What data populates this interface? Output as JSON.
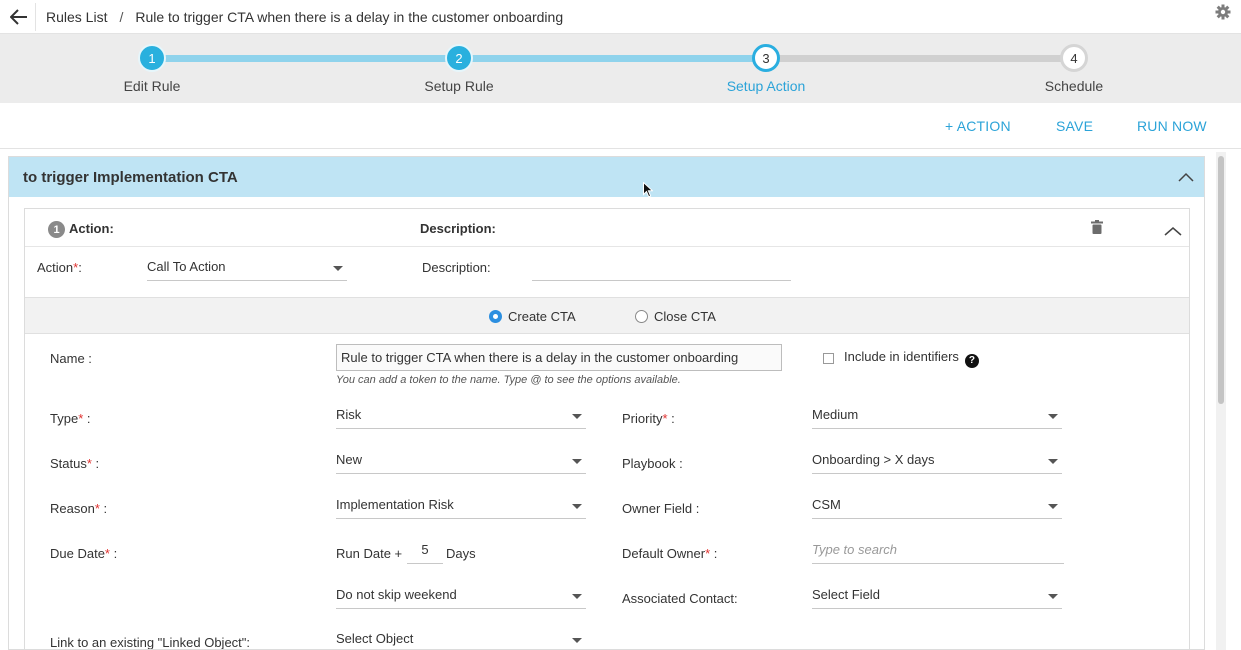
{
  "breadcrumb": {
    "root": "Rules List",
    "separator": "/",
    "current": "Rule to trigger CTA when there is a delay in the customer onboarding"
  },
  "stepper": {
    "steps": [
      {
        "number": "1",
        "label": "Edit Rule",
        "state": "done"
      },
      {
        "number": "2",
        "label": "Setup Rule",
        "state": "done"
      },
      {
        "number": "3",
        "label": "Setup Action",
        "state": "active"
      },
      {
        "number": "4",
        "label": "Schedule",
        "state": "todo"
      }
    ]
  },
  "toolbar": {
    "add_action": "+ ACTION",
    "save": "SAVE",
    "run_now": "RUN NOW"
  },
  "panel": {
    "title": "to trigger Implementation CTA"
  },
  "action": {
    "index": "1",
    "header_action_label": "Action:",
    "header_description_label": "Description:",
    "action_label": "Action",
    "action_value": "Call To Action",
    "description_label": "Description:",
    "description_value": ""
  },
  "cta_mode": {
    "create_label": "Create CTA",
    "close_label": "Close CTA",
    "selected": "create"
  },
  "form": {
    "name_label": "Name :",
    "name_value": "Rule to trigger CTA when there is a delay in the customer onboarding",
    "name_hint": "You can add a token to the name. Type @ to see the options available.",
    "include_identifiers_label": "Include in identifiers",
    "type_label": "Type",
    "type_value": "Risk",
    "priority_label": "Priority",
    "priority_value": "Medium",
    "status_label": "Status",
    "status_value": "New",
    "playbook_label": "Playbook :",
    "playbook_value": "Onboarding > X days",
    "reason_label": "Reason",
    "reason_value": "Implementation Risk",
    "owner_field_label": "Owner Field :",
    "owner_field_value": "CSM",
    "due_date_label": "Due Date",
    "due_date_prefix": "Run Date +",
    "due_date_days": "5",
    "due_date_suffix": "Days",
    "default_owner_label": "Default Owner",
    "default_owner_placeholder": "Type to search",
    "skip_weekend_value": "Do not skip weekend",
    "associated_contact_label": "Associated Contact:",
    "associated_contact_value": "Select Field",
    "linked_object_label": "Link to an existing \"Linked Object\":",
    "linked_object_value": "Select Object"
  },
  "colors": {
    "accent": "#2ba3d8",
    "panel_header": "#bfe4f4",
    "required": "#e0312f"
  }
}
